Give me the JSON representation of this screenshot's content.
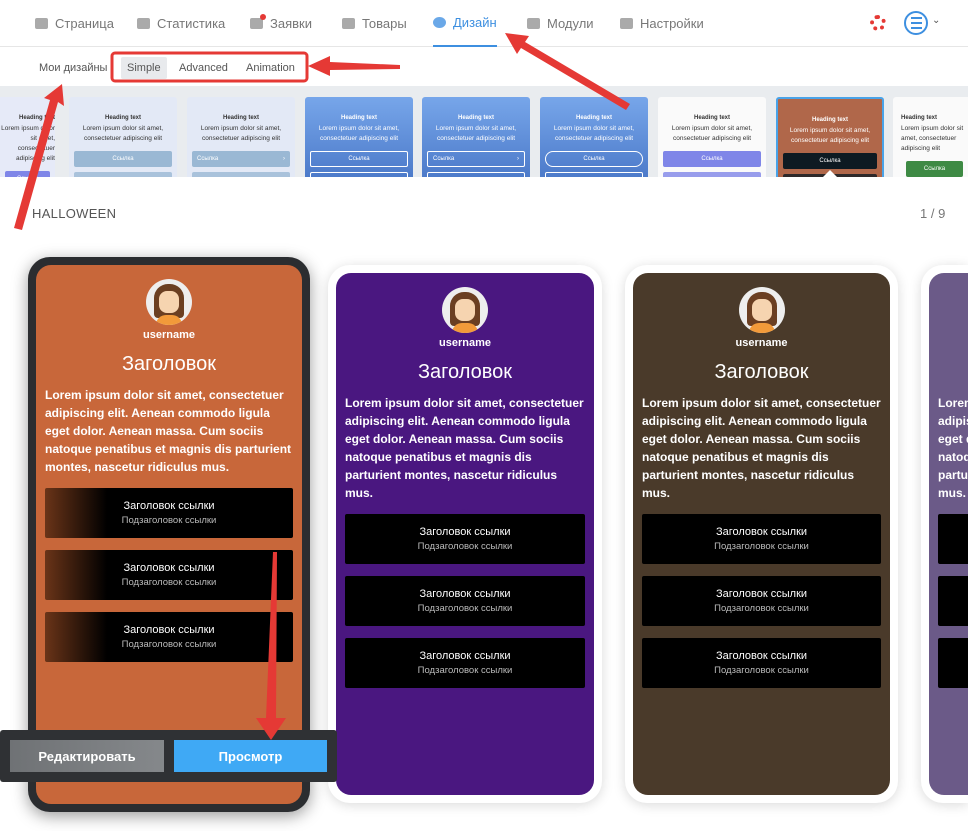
{
  "nav": {
    "items": [
      {
        "label": "Страница",
        "icon": "page-icon",
        "active": false
      },
      {
        "label": "Статистика",
        "icon": "stats-icon",
        "active": false
      },
      {
        "label": "Заявки",
        "icon": "requests-icon",
        "active": false
      },
      {
        "label": "Товары",
        "icon": "store-icon",
        "active": false
      },
      {
        "label": "Дизайн",
        "icon": "palette-icon",
        "active": true
      },
      {
        "label": "Модули",
        "icon": "layers-icon",
        "active": false
      },
      {
        "label": "Настройки",
        "icon": "gear-icon",
        "active": false
      }
    ],
    "accent": "#3d8fe0"
  },
  "subtabs": {
    "my_designs": "Мои дизайны",
    "items": [
      "Simple",
      "Advanced",
      "Animation"
    ],
    "active": "Simple"
  },
  "thumbnails": {
    "heading": "Heading text",
    "text": "Lorem ipsum dolor sit amet, consectetuer adipiscing elit",
    "link": "Ссылка",
    "items": [
      {
        "bg": "#e6eaf8",
        "color": "#333",
        "btn": "#7f86e8"
      },
      {
        "bg": "#e3e9f6",
        "color": "#333",
        "btn": "#9ab8d4"
      },
      {
        "bg": "#e3e9f6",
        "color": "#333",
        "btn": "#9ab8d4",
        "chevron": true
      },
      {
        "bg": "#5a8fd8",
        "color": "#fff",
        "btn": "outline"
      },
      {
        "bg": "#5a8fd8",
        "color": "#fff",
        "btn": "outline",
        "chevron": true
      },
      {
        "bg": "#5a8fd8",
        "color": "#fff",
        "btn": "outline-round"
      },
      {
        "bg": "#fafafa",
        "color": "#333",
        "btn": "#7f86e8"
      },
      {
        "bg": "#b0674a",
        "color": "#fff",
        "btn": "#0e1a22",
        "selected": true
      },
      {
        "bg": "#fafafa",
        "color": "#333",
        "btn": "#3e8a44"
      }
    ]
  },
  "section": {
    "title": "HALLOWEEN",
    "pager": "1 / 9"
  },
  "cards": [
    {
      "bg": "#c8673a",
      "selected": true
    },
    {
      "bg": "#4a1780",
      "selected": false
    },
    {
      "bg": "#4a3a2a",
      "selected": false
    },
    {
      "bg": "#6b5a88",
      "selected": false
    }
  ],
  "card_content": {
    "username": "username",
    "title": "Заголовок",
    "text": "Lorem ipsum dolor sit amet, consectetuer adipiscing elit. Aenean commodo ligula eget dolor. Aenean massa. Cum sociis natoque penatibus et magnis dis parturient montes, nascetur ridiculus mus.",
    "link_title": "Заголовок ссылки",
    "link_subtitle": "Подзаголовок ссылки"
  },
  "actions": {
    "edit": "Редактировать",
    "preview": "Просмотр",
    "preview_color": "#3fa9f5"
  }
}
